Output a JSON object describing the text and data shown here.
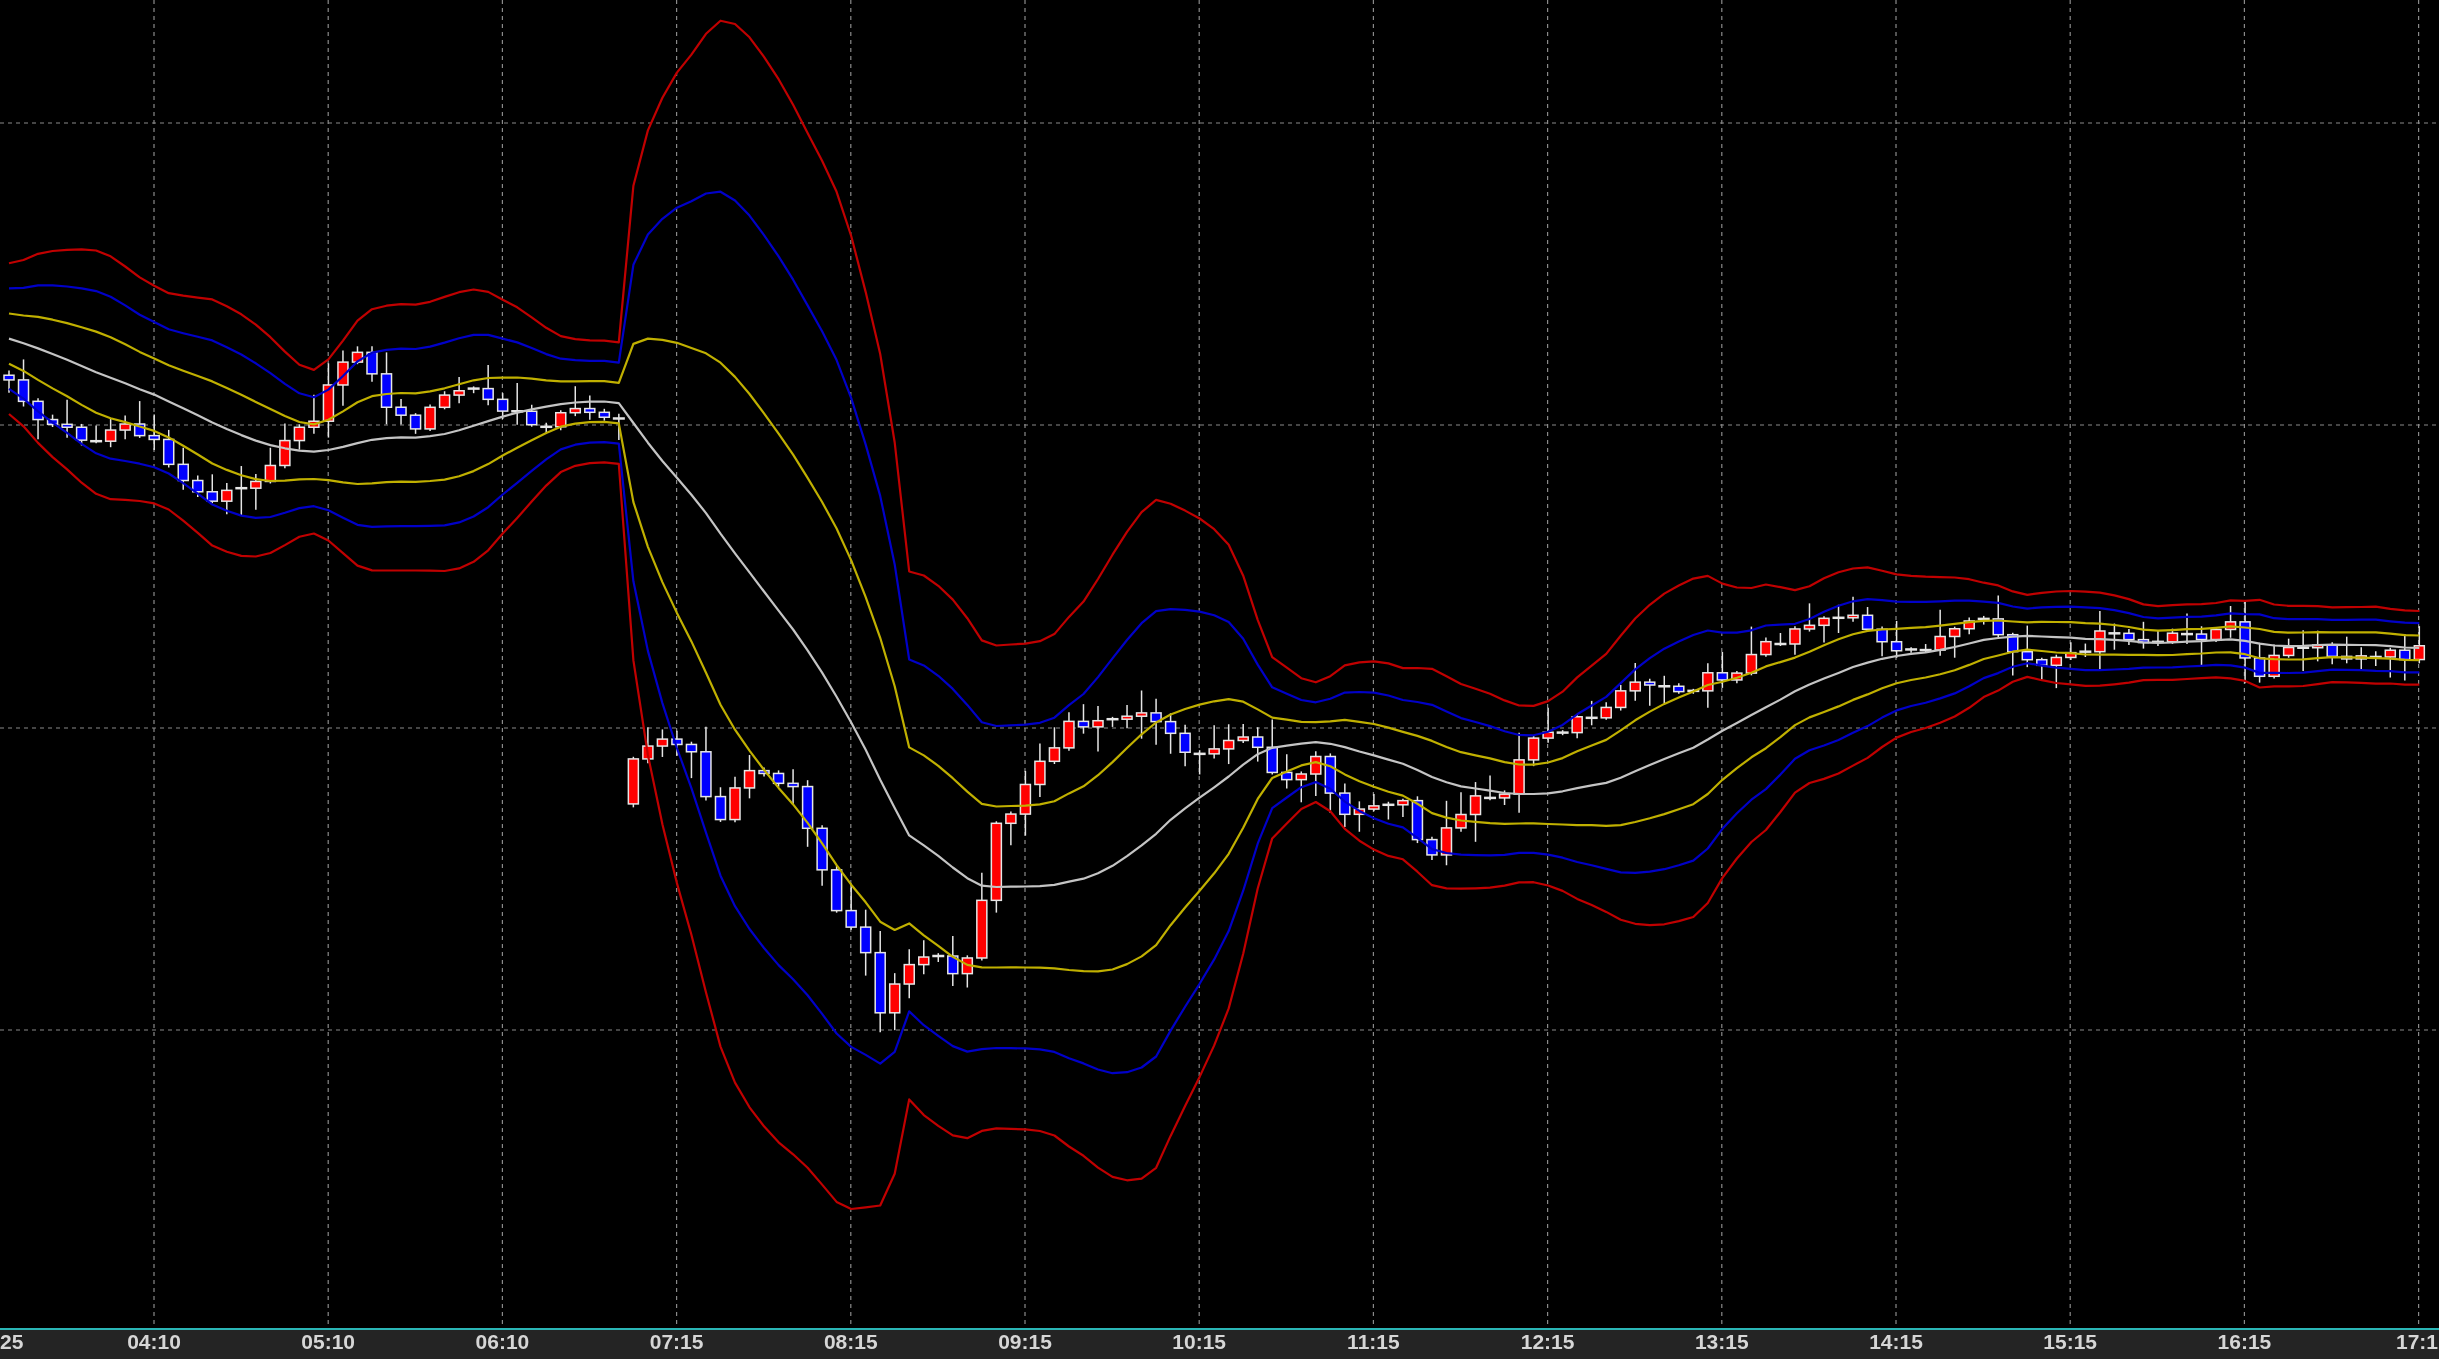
{
  "chart": {
    "time_axis": {
      "labels": [
        "25",
        "04:10",
        "05:10",
        "06:10",
        "07:15",
        "08:15",
        "09:15",
        "10:15",
        "11:15",
        "12:15",
        "13:15",
        "14:15",
        "15:15",
        "16:15",
        "17:1"
      ]
    }
  }
}
